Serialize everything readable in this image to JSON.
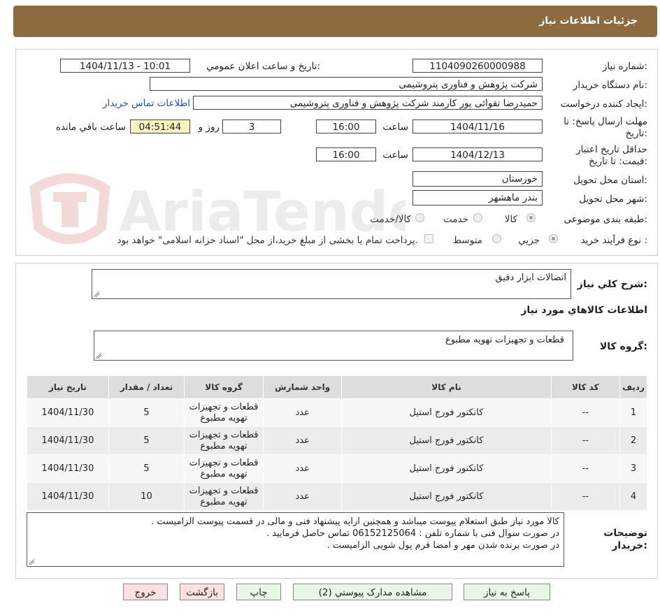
{
  "header": {
    "title": "جزئیات اطلاعات نیاز"
  },
  "form": {
    "need_number_label": "شماره نیاز:",
    "need_number": "1104090260000988",
    "announce_label": "تاریخ و ساعت اعلان عمومي:",
    "announce_value": "1404/11/13 - 10:01",
    "buyer_org_label": "نام دستگاه خریدار:",
    "buyer_org": "شرکت پژوهش و فناوری پتروشیمی",
    "requester_label": "ایجاد کننده درخواست:",
    "requester": "حمیدرضا تقوائی پور کارمند شرکت پژوهش و فناوری پتروشیمی",
    "contact_link": "اطلاعات تماس خریدار",
    "deadline_label_1": "مهلت ارسال پاسخ: تا",
    "deadline_label_2": "تاریخ:",
    "deadline_date": "1404/11/16",
    "time_label": "ساعت",
    "deadline_time": "16:00",
    "days_value": "3",
    "days_label": "روز و",
    "remaining_time": "04:51:44",
    "remaining_label": "ساعت باقي مانده",
    "validity_label_1": "حداقل تاریخ اعتبار",
    "validity_label_2": "قیمت: تا تاریخ:",
    "validity_date": "1404/12/13",
    "validity_time": "16:00",
    "province_label": "استان محل تحویل:",
    "province": "خوزستان",
    "city_label": "شهر محل تحویل:",
    "city": "بندر ماهشهر",
    "category_label": "طبقه بندی موضوعی:",
    "category_options": [
      "کالا",
      "خدمت",
      "کالا/خدمت"
    ],
    "purchase_type_label": "نوع فرآیند خرید :",
    "purchase_options": [
      "جزیي",
      "متوسط"
    ],
    "payment_note": "پرداخت تمام یا بخشی از مبلغ خرید،از محل \"اسناد خزانه اسلامی\" خواهد بود."
  },
  "summary": {
    "general_desc_label": "شرح کلي نیاز:",
    "general_desc": "اتصالات ابزار دقیق",
    "goods_info_title": "اطلاعات کالاهاي مورد نیاز",
    "goods_group_label": "گروه کالا:",
    "goods_group": "قطعات و تجهیزات تهویه مطبوع"
  },
  "table": {
    "headers": [
      "ردیف",
      "کد کالا",
      "نام کالا",
      "واحد شمارش",
      "گروه کالا",
      "تعداد / مقدار",
      "تاریخ نیاز"
    ],
    "rows": [
      [
        "1",
        "--",
        "کانکتور فورج استیل",
        "عدد",
        "قطعات و تجهیزات تهویه مطبوع",
        "5",
        "1404/11/30"
      ],
      [
        "2",
        "--",
        "کانکتور فورج استیل",
        "عدد",
        "قطعات و تجهیزات تهویه مطبوع",
        "5",
        "1404/11/30"
      ],
      [
        "3",
        "--",
        "کانکتور فورج استیل",
        "عدد",
        "قطعات و تجهیزات تهویه مطبوع",
        "5",
        "1404/11/30"
      ],
      [
        "4",
        "--",
        "کانکتور فورج استیل",
        "عدد",
        "قطعات و تجهیزات تهویه مطبوع",
        "10",
        "1404/11/30"
      ]
    ]
  },
  "buyer_notes": {
    "label_1": "توضیحات",
    "label_2": "خریدار:",
    "lines": [
      "کالا مورد نیاز طبق استعلام پیوست میباشد و همچنین ارایه پیشنهاد فنی و مالی در قسمت پیوست الزامیست .",
      "در صورت سوال فنی با شماره تلفن : 06152125064 تماس حاصل فرمایید .",
      "در صورت برنده شدن مهر و امضا فرم پول شویی الزامیست ."
    ]
  },
  "buttons": {
    "reply": "پاسخ به نیاز",
    "attachments": "مشاهده مدارک پیوستي (2)",
    "print": "چاپ",
    "back": "بازگشت",
    "exit": "خروج"
  },
  "watermark": {
    "text": "AriaTender.neT"
  }
}
